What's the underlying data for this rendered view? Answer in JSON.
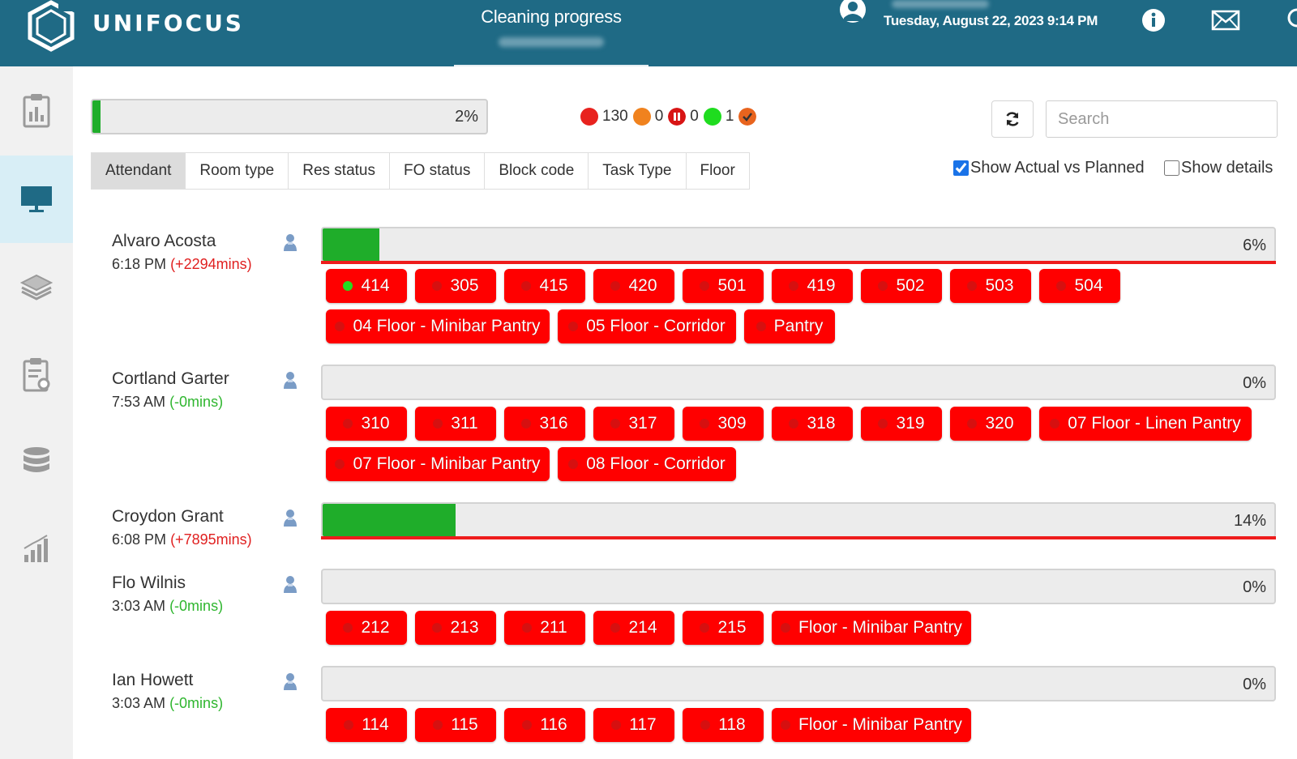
{
  "header": {
    "brand": "UNIFOCUS",
    "title": "Cleaning progress",
    "datetime": "Tuesday, August 22, 2023 9:14 PM",
    "colors": {
      "bar": "#1f6a85"
    }
  },
  "sidebar": {
    "items": [
      {
        "icon": "clipboard-chart-icon"
      },
      {
        "icon": "monitor-icon",
        "active": true
      },
      {
        "icon": "layers-icon"
      },
      {
        "icon": "clipboard-settings-icon"
      },
      {
        "icon": "database-icon"
      },
      {
        "icon": "bar-chart-icon"
      }
    ]
  },
  "overall": {
    "progress": 0.02,
    "percent_label": "2%"
  },
  "legend": {
    "red_count": "130",
    "orange_count": "0",
    "paused_count": "0",
    "green_count": "1",
    "colors": {
      "red": "#e8221e",
      "orange": "#f0821e",
      "paused": "#d81414",
      "green": "#1fdc1f",
      "done": "#e8641e"
    }
  },
  "search": {
    "placeholder": "Search"
  },
  "tabs": [
    "Attendant",
    "Room type",
    "Res status",
    "FO status",
    "Block code",
    "Task Type",
    "Floor"
  ],
  "options": {
    "show_actual_label": "Show Actual vs Planned",
    "show_details_label": "Show details"
  },
  "attendants": [
    {
      "name": "Alvaro Acosta",
      "time": "6:18 PM",
      "delta": "(+2294mins)",
      "progress": 0.06,
      "percent": "6%",
      "rooms": [
        "414",
        "305",
        "415",
        "420",
        "501",
        "419",
        "502",
        "503",
        "504"
      ],
      "areas": [
        "04 Floor - Minibar Pantry",
        "05 Floor - Corridor",
        "Pantry"
      ]
    },
    {
      "name": "Cortland Garter",
      "time": "7:53 AM",
      "delta": "(-0mins)",
      "progress": 0,
      "percent": "0%",
      "rooms": [
        "310",
        "311",
        "316",
        "317",
        "309",
        "318",
        "319",
        "320"
      ],
      "areas": [
        "07 Floor - Linen Pantry",
        "07 Floor - Minibar Pantry",
        "08 Floor - Corridor"
      ]
    },
    {
      "name": "Croydon Grant",
      "time": "6:08 PM",
      "delta": "(+7895mins)",
      "progress": 0.14,
      "percent": "14%"
    },
    {
      "name": "Flo Wilnis",
      "time": "3:03 AM",
      "delta": "(-0mins)",
      "progress": 0,
      "percent": "0%",
      "rooms": [
        "212",
        "213",
        "211",
        "214",
        "215"
      ],
      "areas": [
        "Floor - Minibar Pantry"
      ]
    },
    {
      "name": "Ian Howett",
      "time": "3:03 AM",
      "delta": "(-0mins)",
      "progress": 0,
      "percent": "0%",
      "rooms": [
        "114",
        "115",
        "116",
        "117",
        "118"
      ],
      "areas": [
        "Floor - Minibar Pantry"
      ]
    }
  ]
}
